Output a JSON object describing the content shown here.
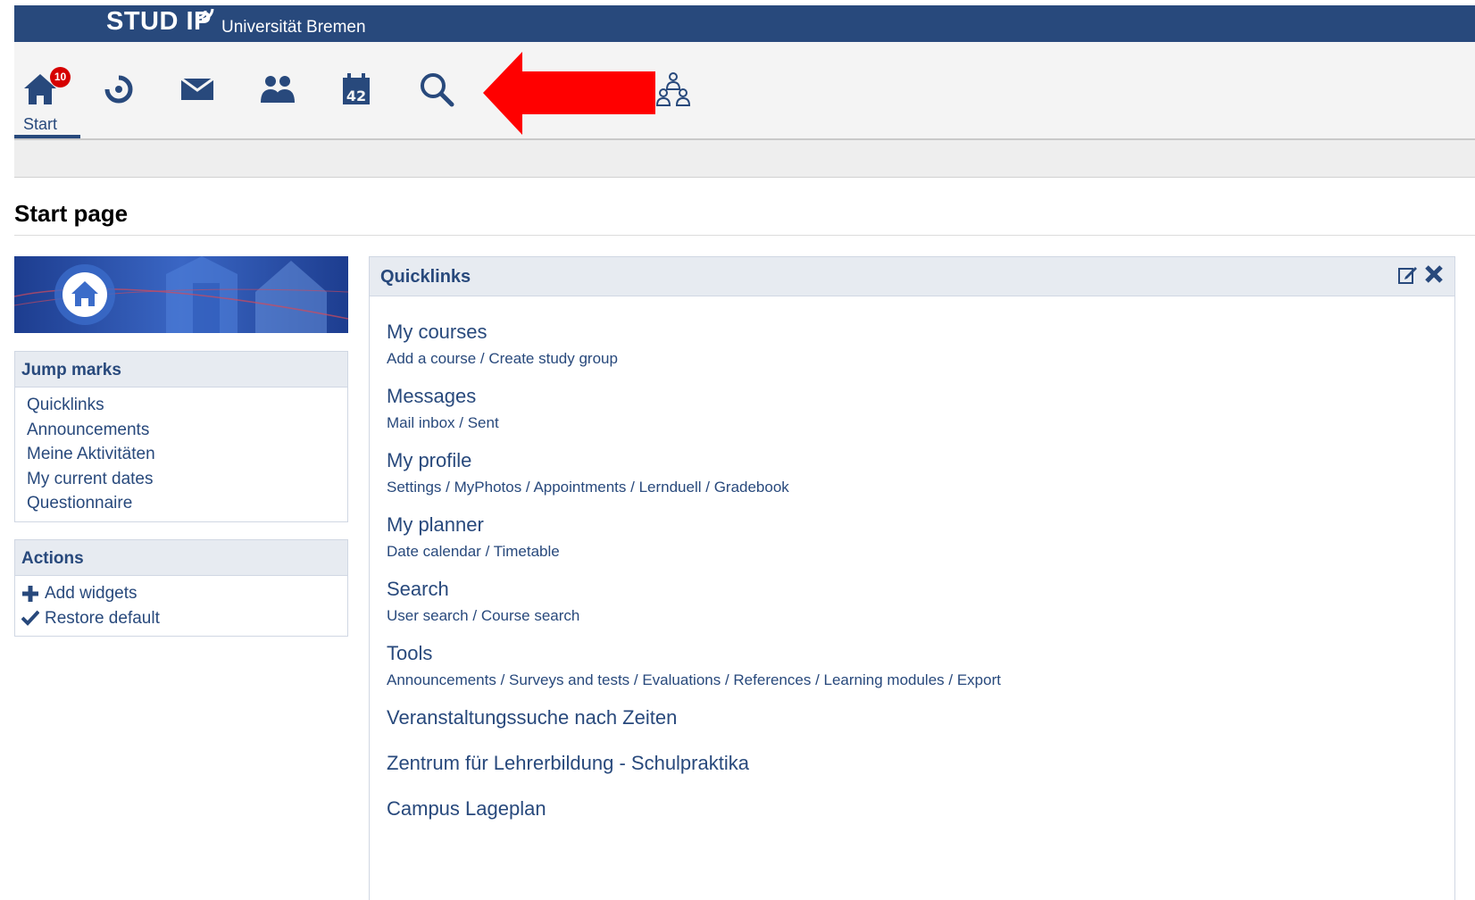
{
  "header": {
    "logo": "STUD IP",
    "university": "Universität Bremen"
  },
  "nav": {
    "start_label": "Start",
    "badge_count": "10",
    "icons": [
      "home-icon",
      "activity-icon",
      "mail-icon",
      "community-icon",
      "calendar-icon",
      "search-icon",
      "group-icon"
    ]
  },
  "page": {
    "title": "Start page"
  },
  "jump_marks": {
    "title": "Jump marks",
    "items": [
      "Quicklinks",
      "Announcements",
      "Meine Aktivitäten",
      "My current dates",
      "Questionnaire"
    ]
  },
  "actions": {
    "title": "Actions",
    "items": [
      "Add widgets",
      "Restore default"
    ]
  },
  "quicklinks": {
    "title": "Quicklinks",
    "groups": [
      {
        "title": "My courses",
        "links": [
          "Add a course",
          "Create study group"
        ]
      },
      {
        "title": "Messages",
        "links": [
          "Mail inbox",
          "Sent"
        ]
      },
      {
        "title": "My profile",
        "links": [
          "Settings",
          "MyPhotos",
          "Appointments",
          "Lernduell",
          "Gradebook"
        ]
      },
      {
        "title": "My planner",
        "links": [
          "Date calendar",
          "Timetable"
        ]
      },
      {
        "title": "Search",
        "links": [
          "User search",
          "Course search"
        ]
      },
      {
        "title": "Tools",
        "links": [
          "Announcements",
          "Surveys and tests",
          "Evaluations",
          "References",
          "Learning modules",
          "Export"
        ]
      },
      {
        "title": "Veranstaltungssuche nach Zeiten",
        "links": []
      },
      {
        "title": "Zentrum für Lehrerbildung - Schulpraktika",
        "links": []
      },
      {
        "title": "Campus Lageplan",
        "links": []
      }
    ]
  },
  "colors": {
    "brand": "#28497c",
    "arrow": "#ff0000",
    "badge": "#d60000"
  }
}
